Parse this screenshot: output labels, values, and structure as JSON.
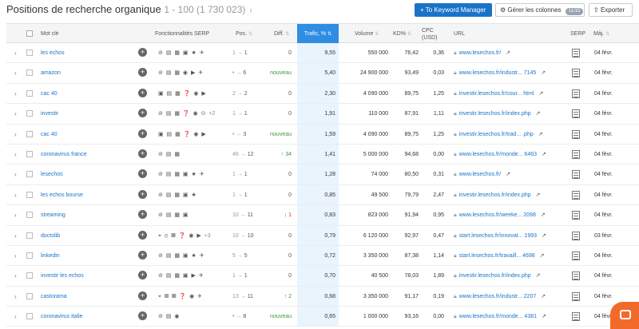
{
  "header": {
    "title": "Positions de recherche organique",
    "range": "1 - 100 (1 730 023)",
    "info_icon": "i",
    "keyword_manager_label": "+ To Keyword Manager",
    "columns_label": "Gérer les colonnes",
    "columns_badge": "11/15",
    "export_label": "Exporter"
  },
  "columns": {
    "keyword": "Mot clé",
    "features": "Fonctionnalités SERP",
    "pos": "Pos.",
    "diff": "Diff.",
    "traffic": "Trafic, %",
    "volume": "Volume",
    "kd": "KD%",
    "cpc": "CPC (USD)",
    "url": "URL",
    "serp": "SERP",
    "updated": "Màj."
  },
  "rows": [
    {
      "kw": "les echos",
      "feat": "⊘ ▤ ▦ ▣ ★ ✈",
      "more": "",
      "pos_prev": "1",
      "pos_cur": "1",
      "diff": "0",
      "dtype": "zero",
      "traffic": "9,55",
      "volume": "550 000",
      "kd": "76,42",
      "cpc": "0,36",
      "url": "www.lesechos.fr/",
      "date": "04 févr."
    },
    {
      "kw": "amazon",
      "feat": "⊘ ▤ ▦ ◉ ▶ ✈",
      "more": "",
      "pos_prev": "•",
      "pos_cur": "6",
      "diff": "nouveau",
      "dtype": "new",
      "traffic": "5,40",
      "volume": "24 900 000",
      "kd": "93,49",
      "cpc": "0,03",
      "url": "www.lesechos.fr/industr... 7145",
      "date": "04 févr."
    },
    {
      "kw": "cac 40",
      "feat": "▣ ▤ ▦ ❓ ◉ ▶",
      "more": "",
      "pos_prev": "2",
      "pos_cur": "2",
      "diff": "0",
      "dtype": "zero",
      "traffic": "2,30",
      "volume": "4 090 000",
      "kd": "89,75",
      "cpc": "1,25",
      "url": "investir.lesechos.fr/cour... html",
      "date": "04 févr."
    },
    {
      "kw": "investir",
      "feat": "⊘ ▤ ▦ ❓ ◉ ⊙",
      "more": "+2",
      "pos_prev": "1",
      "pos_cur": "1",
      "diff": "0",
      "dtype": "zero",
      "traffic": "1,91",
      "volume": "110 000",
      "kd": "87,91",
      "cpc": "1,11",
      "url": "investir.lesechos.fr/index.php",
      "date": "04 févr."
    },
    {
      "kw": "cac 40",
      "feat": "▣ ▤ ▦ ❓ ◉ ▶",
      "more": "",
      "pos_prev": "•",
      "pos_cur": "3",
      "diff": "nouveau",
      "dtype": "new",
      "traffic": "1,59",
      "volume": "4 090 000",
      "kd": "89,75",
      "cpc": "1,25",
      "url": "investir.lesechos.fr/trad... .php",
      "date": "04 févr."
    },
    {
      "kw": "coronavirus france",
      "feat": "⊘ ▤ ▦",
      "more": "",
      "pos_prev": "46",
      "pos_cur": "12",
      "diff": "↑ 34",
      "dtype": "up",
      "traffic": "1,41",
      "volume": "5 000 000",
      "kd": "94,68",
      "cpc": "0,00",
      "url": "www.lesechos.fr/monde... 6463",
      "date": "04 févr."
    },
    {
      "kw": "lesechos",
      "feat": "⊘ ▤ ▦ ▣ ★ ✈",
      "more": "",
      "pos_prev": "1",
      "pos_cur": "1",
      "diff": "0",
      "dtype": "zero",
      "traffic": "1,28",
      "volume": "74 000",
      "kd": "80,50",
      "cpc": "0,31",
      "url": "www.lesechos.fr/",
      "date": "04 févr."
    },
    {
      "kw": "les echos bourse",
      "feat": "⊘ ▤ ▦ ▣ ★",
      "more": "",
      "pos_prev": "1",
      "pos_cur": "1",
      "diff": "0",
      "dtype": "zero",
      "traffic": "0,85",
      "volume": "49 500",
      "kd": "79,79",
      "cpc": "2,47",
      "url": "investir.lesechos.fr/index.php",
      "date": "04 févr."
    },
    {
      "kw": "streaming",
      "feat": "⊘ ▤ ▦ ▣",
      "more": "",
      "pos_prev": "10",
      "pos_cur": "11",
      "diff": "↓ 1",
      "dtype": "down",
      "traffic": "0,83",
      "volume": "823 000",
      "kd": "91,94",
      "cpc": "0,95",
      "url": "www.lesechos.fr/weeke... 2098",
      "date": "04 févr."
    },
    {
      "kw": "doctolib",
      "feat": "⌖ ⊘ ▦ ❓ ◉ ▶",
      "more": "+3",
      "pos_prev": "10",
      "pos_cur": "10",
      "diff": "0",
      "dtype": "zero",
      "traffic": "0,79",
      "volume": "6 120 000",
      "kd": "92,97",
      "cpc": "0,47",
      "url": "start.lesechos.fr/innovat... 1993",
      "date": "03 févr."
    },
    {
      "kw": "linkedin",
      "feat": "⊘ ▤ ▦ ▣ ★ ✈",
      "more": "",
      "pos_prev": "5",
      "pos_cur": "5",
      "diff": "0",
      "dtype": "zero",
      "traffic": "0,72",
      "volume": "3 350 000",
      "kd": "87,38",
      "cpc": "1,14",
      "url": "start.lesechos.fr/travaill... 4698",
      "date": "04 févr."
    },
    {
      "kw": "investir les echos",
      "feat": "⊘ ▤ ▦ ▣ ▶ ✈",
      "more": "",
      "pos_prev": "1",
      "pos_cur": "1",
      "diff": "0",
      "dtype": "zero",
      "traffic": "0,70",
      "volume": "40 500",
      "kd": "78,03",
      "cpc": "1,89",
      "url": "investir.lesechos.fr/index.php",
      "date": "04 févr."
    },
    {
      "kw": "castorama",
      "feat": "⌖ ▤ ▦ ❓ ◉ ✈",
      "more": "",
      "pos_prev": "13",
      "pos_cur": "11",
      "diff": "↑ 2",
      "dtype": "up",
      "traffic": "0,68",
      "volume": "3 350 000",
      "kd": "91,17",
      "cpc": "0,19",
      "url": "www.lesechos.fr/industr... 2207",
      "date": "04 févr."
    },
    {
      "kw": "coronavirus italie",
      "feat": "⊘ ▤ ◉",
      "more": "",
      "pos_prev": "•",
      "pos_cur": "8",
      "diff": "nouveau",
      "dtype": "new",
      "traffic": "0,65",
      "volume": "1 000 000",
      "kd": "93,16",
      "cpc": "0,00",
      "url": "www.lesechos.fr/monde... 4381",
      "date": "04 févr."
    }
  ]
}
